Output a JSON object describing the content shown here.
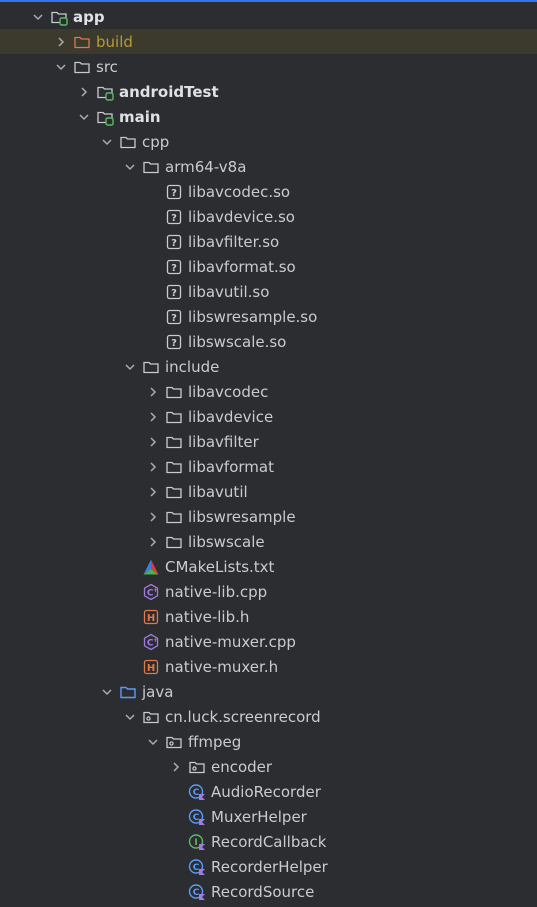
{
  "tree": [
    {
      "label": "app",
      "depth": 0,
      "chevron": "down",
      "icon": "module-folder",
      "bold": true
    },
    {
      "label": "build",
      "depth": 1,
      "chevron": "right",
      "icon": "excluded-folder",
      "color": "olive",
      "selected": true
    },
    {
      "label": "src",
      "depth": 1,
      "chevron": "down",
      "icon": "folder"
    },
    {
      "label": "androidTest",
      "depth": 2,
      "chevron": "right",
      "icon": "module-folder",
      "bold": true
    },
    {
      "label": "main",
      "depth": 2,
      "chevron": "down",
      "icon": "module-folder",
      "bold": true
    },
    {
      "label": "cpp",
      "depth": 3,
      "chevron": "down",
      "icon": "folder"
    },
    {
      "label": "arm64-v8a",
      "depth": 4,
      "chevron": "down",
      "icon": "folder"
    },
    {
      "label": "libavcodec.so",
      "depth": 5,
      "chevron": "none",
      "icon": "unknown-file"
    },
    {
      "label": "libavdevice.so",
      "depth": 5,
      "chevron": "none",
      "icon": "unknown-file"
    },
    {
      "label": "libavfilter.so",
      "depth": 5,
      "chevron": "none",
      "icon": "unknown-file"
    },
    {
      "label": "libavformat.so",
      "depth": 5,
      "chevron": "none",
      "icon": "unknown-file"
    },
    {
      "label": "libavutil.so",
      "depth": 5,
      "chevron": "none",
      "icon": "unknown-file"
    },
    {
      "label": "libswresample.so",
      "depth": 5,
      "chevron": "none",
      "icon": "unknown-file"
    },
    {
      "label": "libswscale.so",
      "depth": 5,
      "chevron": "none",
      "icon": "unknown-file"
    },
    {
      "label": "include",
      "depth": 4,
      "chevron": "down",
      "icon": "folder"
    },
    {
      "label": "libavcodec",
      "depth": 5,
      "chevron": "right",
      "icon": "folder"
    },
    {
      "label": "libavdevice",
      "depth": 5,
      "chevron": "right",
      "icon": "folder"
    },
    {
      "label": "libavfilter",
      "depth": 5,
      "chevron": "right",
      "icon": "folder"
    },
    {
      "label": "libavformat",
      "depth": 5,
      "chevron": "right",
      "icon": "folder"
    },
    {
      "label": "libavutil",
      "depth": 5,
      "chevron": "right",
      "icon": "folder"
    },
    {
      "label": "libswresample",
      "depth": 5,
      "chevron": "right",
      "icon": "folder"
    },
    {
      "label": "libswscale",
      "depth": 5,
      "chevron": "right",
      "icon": "folder"
    },
    {
      "label": "CMakeLists.txt",
      "depth": 4,
      "chevron": "none",
      "icon": "cmake-file"
    },
    {
      "label": "native-lib.cpp",
      "depth": 4,
      "chevron": "none",
      "icon": "cpp-file"
    },
    {
      "label": "native-lib.h",
      "depth": 4,
      "chevron": "none",
      "icon": "header-file"
    },
    {
      "label": "native-muxer.cpp",
      "depth": 4,
      "chevron": "none",
      "icon": "cpp-file"
    },
    {
      "label": "native-muxer.h",
      "depth": 4,
      "chevron": "none",
      "icon": "header-file"
    },
    {
      "label": "java",
      "depth": 3,
      "chevron": "down",
      "icon": "source-folder"
    },
    {
      "label": "cn.luck.screenrecord",
      "depth": 4,
      "chevron": "down",
      "icon": "package-folder"
    },
    {
      "label": "ffmpeg",
      "depth": 5,
      "chevron": "down",
      "icon": "package-folder"
    },
    {
      "label": "encoder",
      "depth": 6,
      "chevron": "right",
      "icon": "package-folder"
    },
    {
      "label": "AudioRecorder",
      "depth": 6,
      "chevron": "none",
      "icon": "kotlin-class"
    },
    {
      "label": "MuxerHelper",
      "depth": 6,
      "chevron": "none",
      "icon": "kotlin-class"
    },
    {
      "label": "RecordCallback",
      "depth": 6,
      "chevron": "none",
      "icon": "kotlin-interface"
    },
    {
      "label": "RecorderHelper",
      "depth": 6,
      "chevron": "none",
      "icon": "kotlin-class"
    },
    {
      "label": "RecordSource",
      "depth": 6,
      "chevron": "none",
      "icon": "kotlin-class"
    }
  ],
  "colors": {
    "background": "#2b2d30",
    "text": "#c8cbd0",
    "selection": "#3c3a2c",
    "excluded": "#b59a3a",
    "accent": "#3574f0"
  }
}
